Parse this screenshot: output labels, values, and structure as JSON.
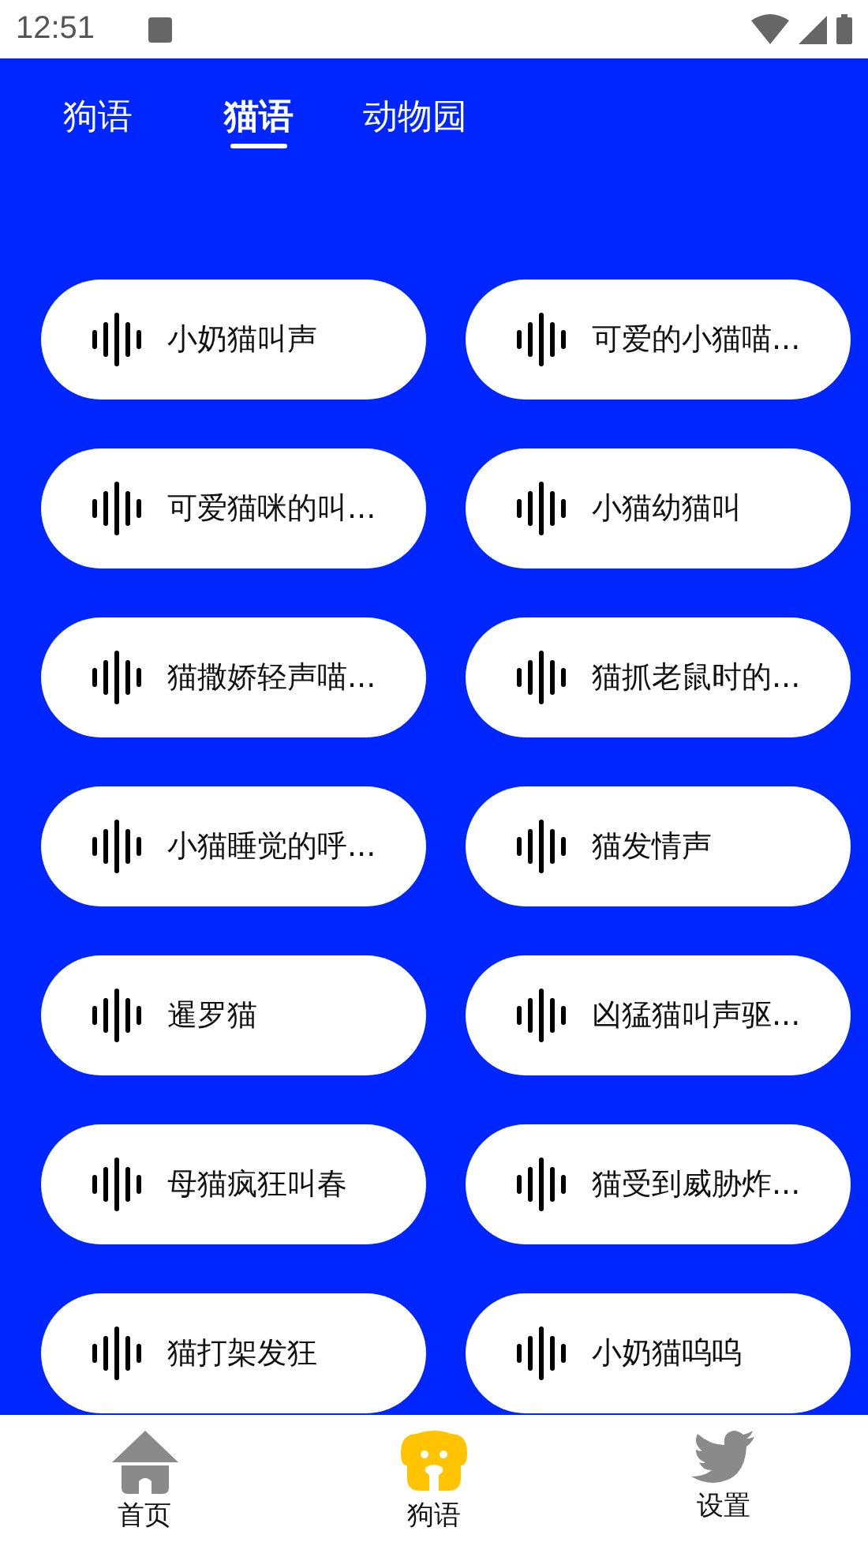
{
  "status_bar": {
    "time": "12:51"
  },
  "tabs": [
    {
      "label": "狗语",
      "selected": false
    },
    {
      "label": "猫语",
      "selected": true
    },
    {
      "label": "动物园",
      "selected": false
    }
  ],
  "sounds": [
    {
      "title": "小奶猫叫声"
    },
    {
      "title": "可爱的小猫喵..."
    },
    {
      "title": "可爱猫咪的叫..."
    },
    {
      "title": "小猫幼猫叫"
    },
    {
      "title": "猫撒娇轻声喵..."
    },
    {
      "title": "猫抓老鼠时的..."
    },
    {
      "title": "小猫睡觉的呼..."
    },
    {
      "title": "猫发情声"
    },
    {
      "title": "暹罗猫"
    },
    {
      "title": "凶猛猫叫声驱..."
    },
    {
      "title": "母猫疯狂叫春"
    },
    {
      "title": "猫受到威胁炸..."
    },
    {
      "title": "猫打架发狂"
    },
    {
      "title": "小奶猫呜呜"
    }
  ],
  "bottom_nav": [
    {
      "label": "首页",
      "kind": "home",
      "selected": false
    },
    {
      "label": "狗语",
      "kind": "dog",
      "selected": true
    },
    {
      "label": "设置",
      "kind": "bird",
      "selected": false
    }
  ]
}
